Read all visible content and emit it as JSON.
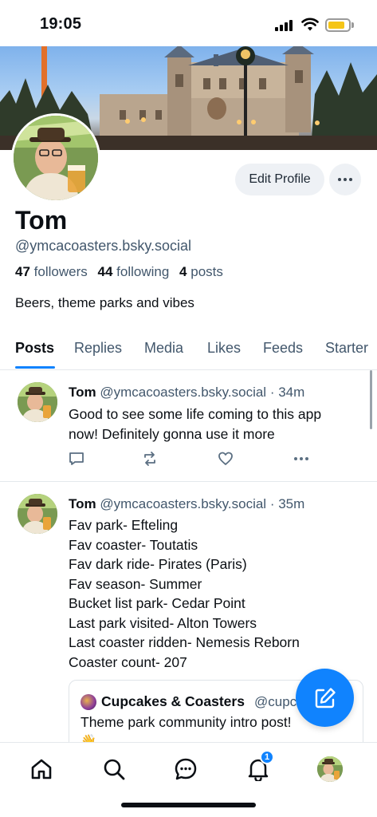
{
  "status_bar": {
    "time": "19:05",
    "battery_color": "#f5c518"
  },
  "profile": {
    "display_name": "Tom",
    "handle": "@ymcacoasters.bsky.social",
    "followers_count": "47",
    "followers_label": "followers",
    "following_count": "44",
    "following_label": "following",
    "posts_count": "4",
    "posts_label": "posts",
    "bio": "Beers, theme parks and vibes",
    "edit_button": "Edit Profile",
    "more_icon": "ellipsis-icon"
  },
  "tabs": [
    {
      "label": "Posts",
      "active": true
    },
    {
      "label": "Replies",
      "active": false
    },
    {
      "label": "Media",
      "active": false
    },
    {
      "label": "Likes",
      "active": false
    },
    {
      "label": "Feeds",
      "active": false
    },
    {
      "label": "Starter",
      "active": false
    }
  ],
  "posts": [
    {
      "author": "Tom",
      "handle": "@ymcacoasters.bsky.social",
      "time": "· 34m",
      "lines": [
        "Good to see some life coming to this app",
        "now! Definitely gonna use it more"
      ]
    },
    {
      "author": "Tom",
      "handle": "@ymcacoasters.bsky.social",
      "time": "· 35m",
      "lines": [
        "Fav park- Efteling",
        "Fav coaster- Toutatis",
        "Fav dark ride- Pirates (Paris)",
        "Fav season- Summer",
        "Bucket list park- Cedar Point",
        "Last park visited- Alton Towers",
        "Last coaster ridden- Nemesis Reborn",
        "Coaster count- 207"
      ],
      "quote": {
        "name": "Cupcakes & Coasters",
        "handle": "@cupc",
        "text": "Theme park community intro post!",
        "emoji": "👋"
      }
    }
  ],
  "nav": {
    "items": [
      "home-icon",
      "search-icon",
      "chat-icon",
      "bell-icon",
      "profile-avatar"
    ],
    "notification_count": "1"
  },
  "colors": {
    "accent": "#1083fe",
    "muted_text": "#42576c",
    "text": "#0b0f14"
  }
}
